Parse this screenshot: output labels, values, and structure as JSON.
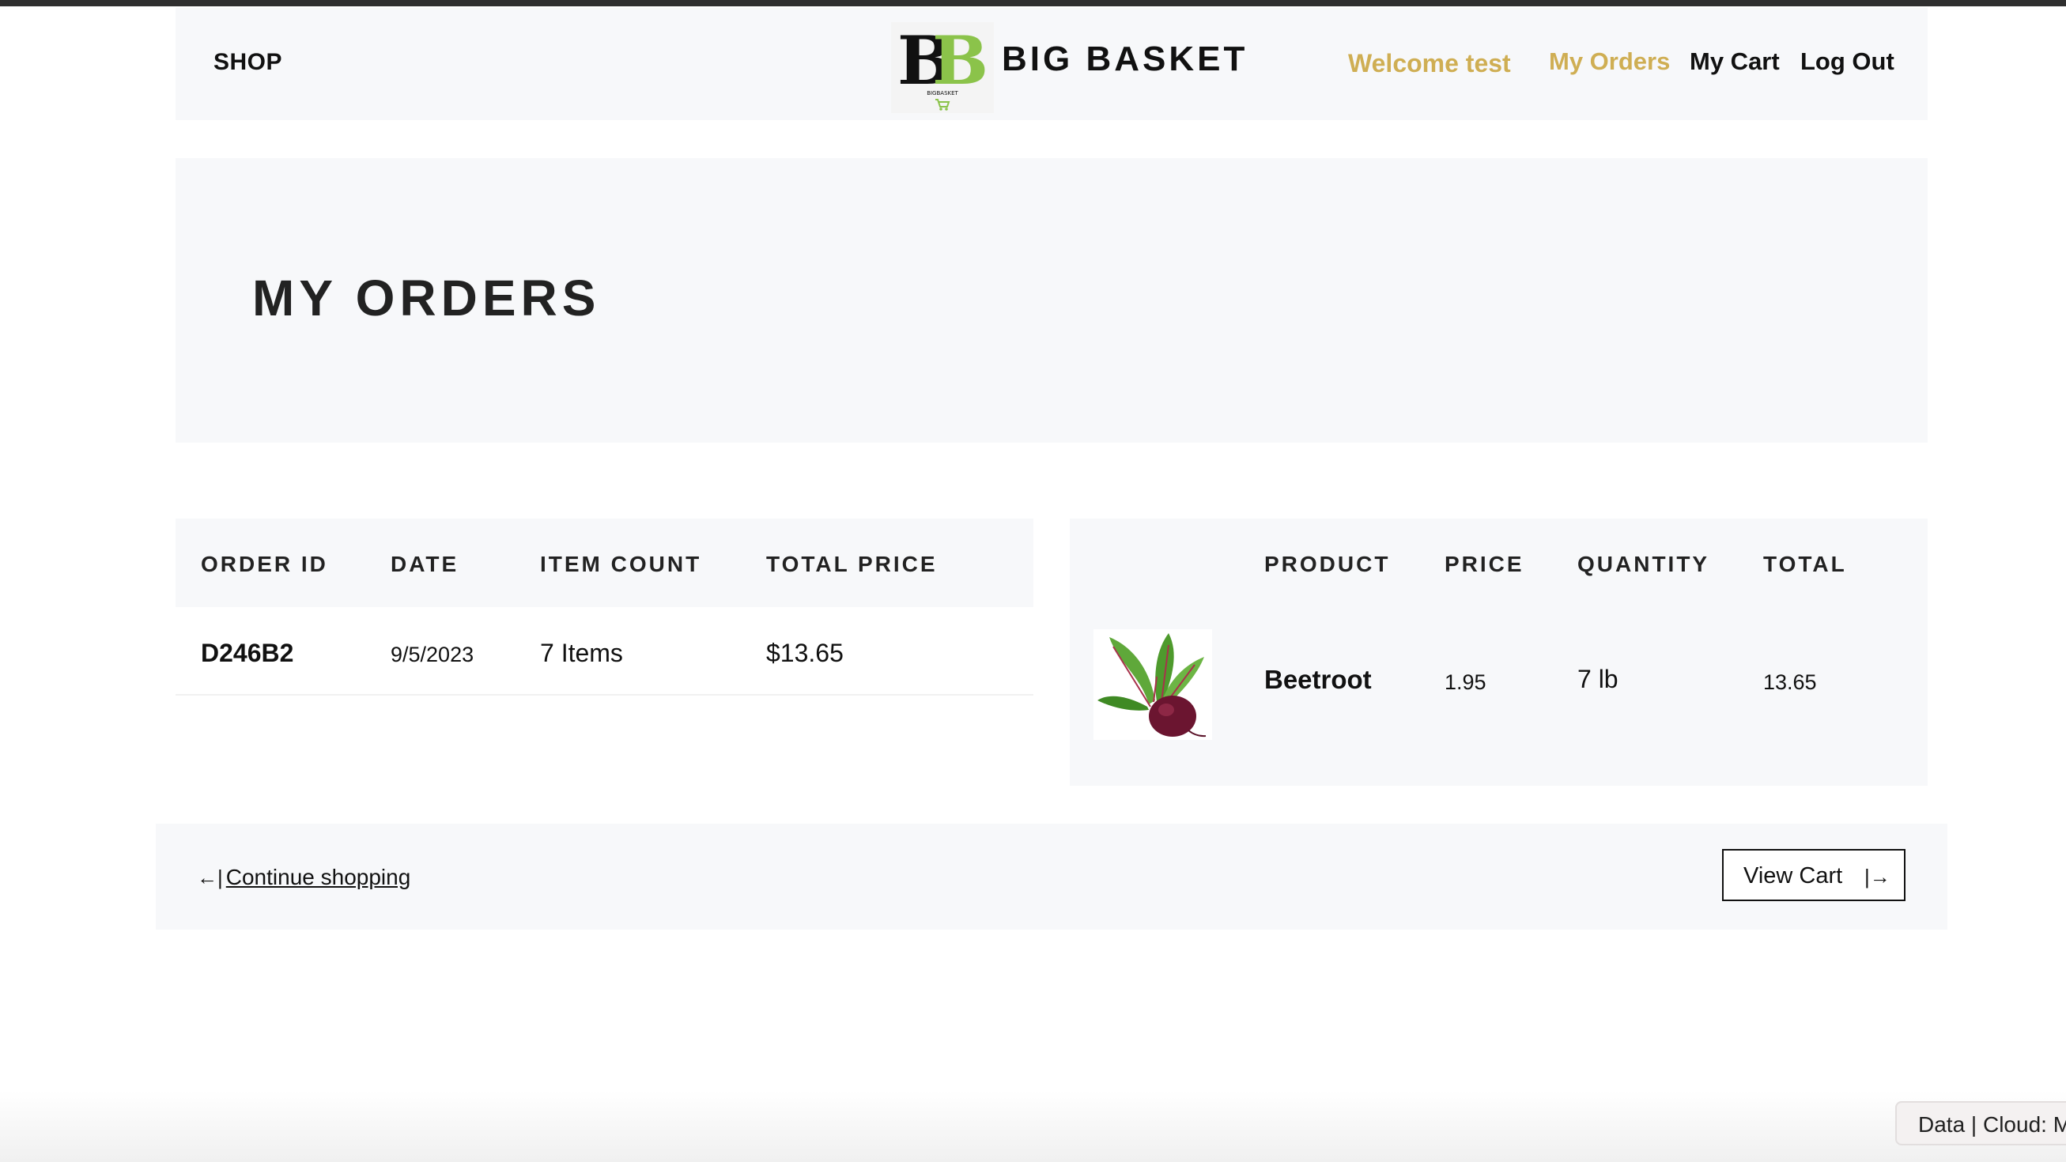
{
  "header": {
    "shop_label": "SHOP",
    "brand_name": "BIG BASKET",
    "logo_text": "BB",
    "logo_subtext": "BIGBASKET",
    "welcome_text": "Welcome test",
    "nav": {
      "my_orders": "My Orders",
      "my_cart": "My Cart",
      "log_out": "Log Out"
    },
    "colors": {
      "accent": "#cfae53",
      "logo_green": "#8bc34a"
    }
  },
  "page_title": "MY ORDERS",
  "orders_table": {
    "headers": [
      "ORDER ID",
      "DATE",
      "ITEM COUNT",
      "TOTAL PRICE"
    ],
    "rows": [
      {
        "order_id": "D246B2",
        "date": "9/5/2023",
        "item_count": "7 Items",
        "total_price": "$13.65"
      }
    ]
  },
  "items_table": {
    "headers": [
      "PRODUCT",
      "PRICE",
      "QUANTITY",
      "TOTAL"
    ],
    "rows": [
      {
        "image_icon": "beetroot-image",
        "product": "Beetroot",
        "price": "1.95",
        "quantity": "7 lb",
        "total": "13.65"
      }
    ]
  },
  "footer": {
    "continue_arrow": "←|",
    "continue_label": "Continue shopping",
    "view_cart_label": "View Cart",
    "view_cart_arrow": "|→"
  },
  "cloud_tab": "Data | Cloud: M"
}
